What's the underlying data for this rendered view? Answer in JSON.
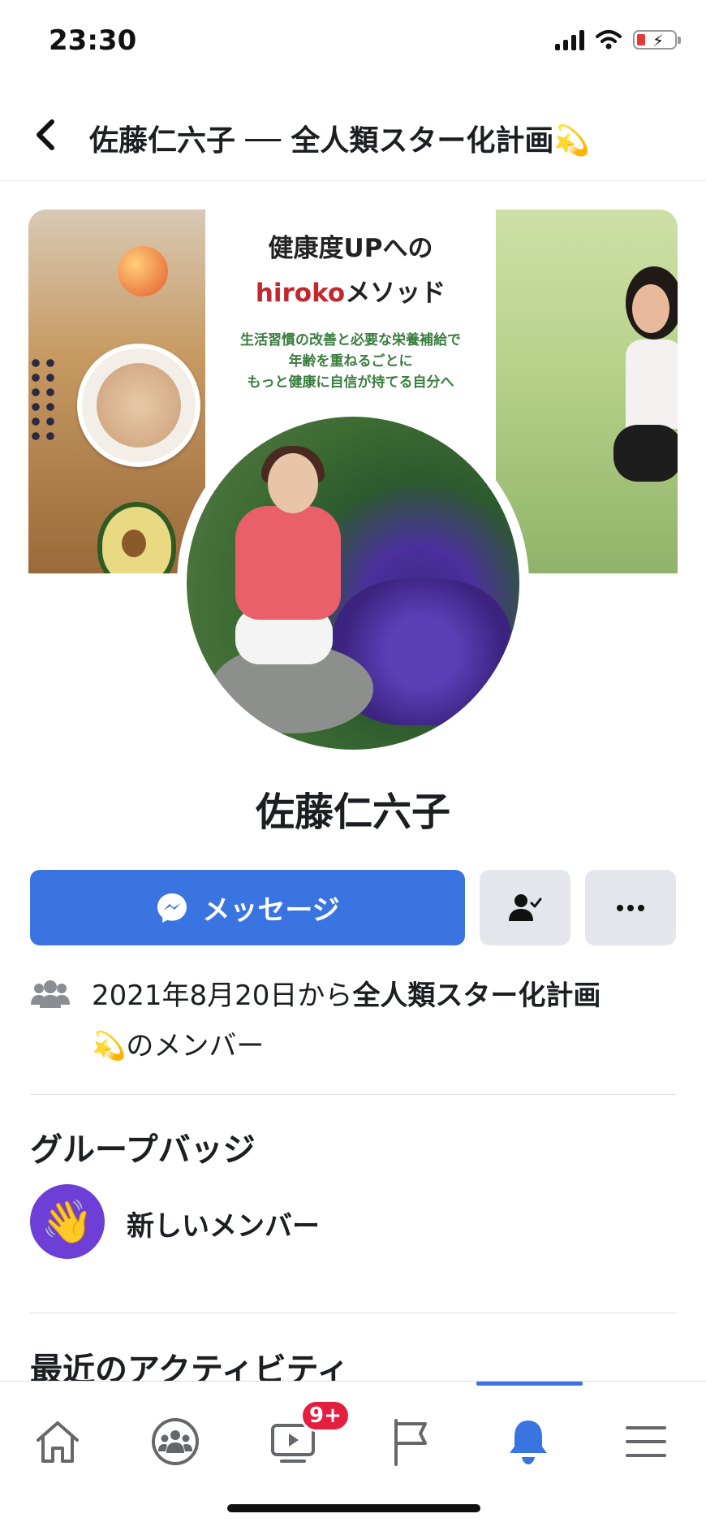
{
  "status": {
    "time": "23:30"
  },
  "header": {
    "title": "佐藤仁六子 ── 全人類スター化計画💫"
  },
  "cover": {
    "line1": "健康度UPへの",
    "line2_red": "hiroko",
    "line2_rest": "メソッド",
    "sub1": "生活習慣の改善と必要な栄養補給で",
    "sub2": "年齢を重ねるごとに",
    "sub3": "もっと健康に自信が持てる自分へ"
  },
  "profile": {
    "name": "佐藤仁六子"
  },
  "actions": {
    "message_label": "メッセージ",
    "more_label": "···"
  },
  "membership": {
    "date_text": "2021年8月20日から",
    "group_name": "全人類スター化計画",
    "suffix": "💫のメンバー"
  },
  "badges": {
    "title": "グループバッジ",
    "items": [
      {
        "icon": "👋",
        "label": "新しいメンバー"
      }
    ]
  },
  "activity": {
    "title": "最近のアクティビティ"
  },
  "tabbar": {
    "watch_badge": "9+",
    "active_tab": "notifications",
    "accent_color": "#3a74e0"
  }
}
